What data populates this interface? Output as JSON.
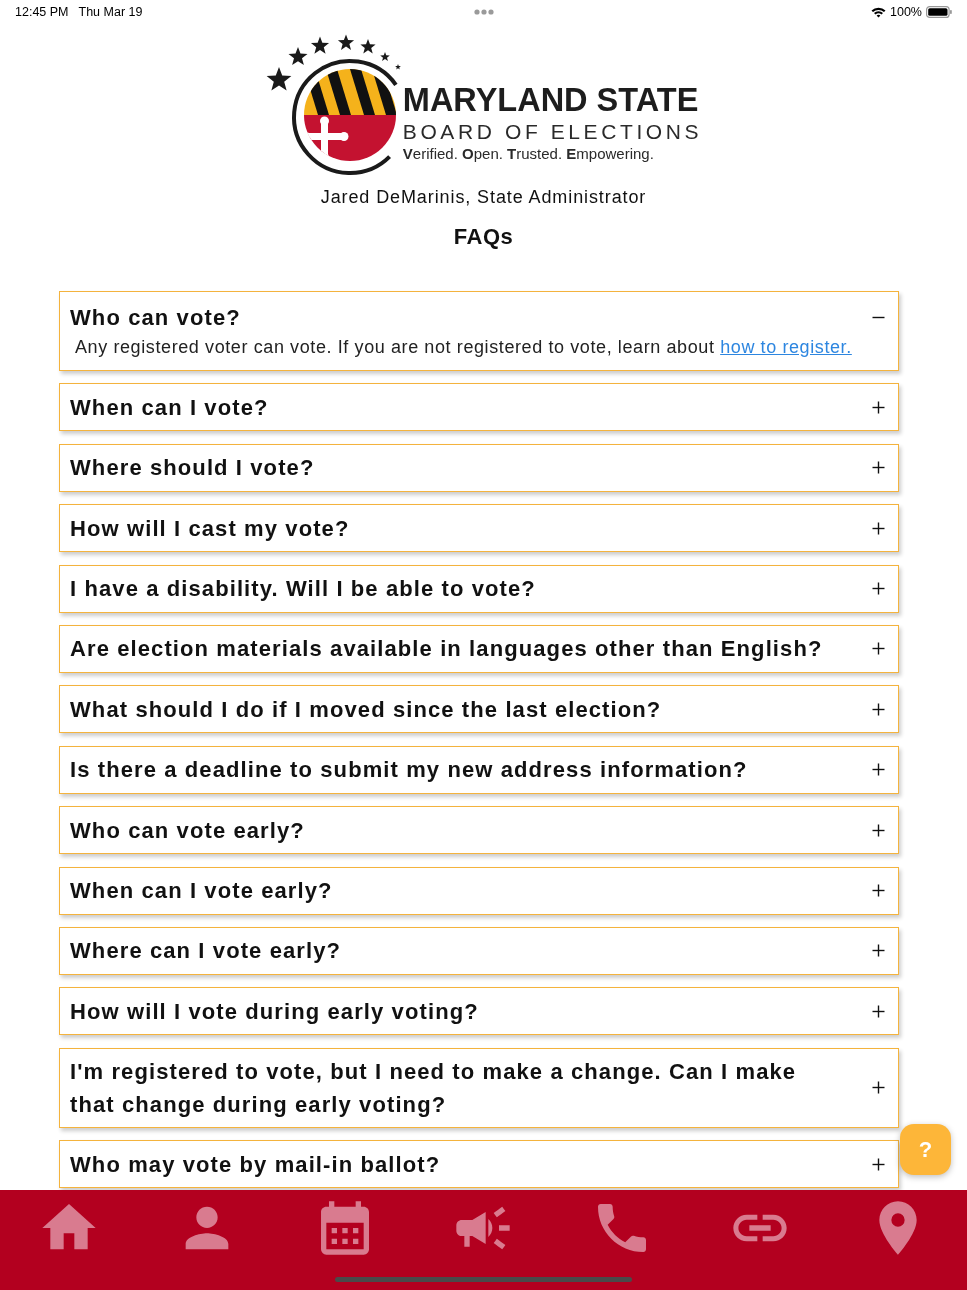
{
  "status_bar": {
    "time": "12:45 PM",
    "date": "Thu Mar 19",
    "battery": "100%"
  },
  "header": {
    "logo_title": "MARYLAND STATE",
    "logo_subtitle": "BOARD OF ELECTIONS",
    "logo_tagline": "**V**erified. **O**pen. **T**rusted. **E**mpowering.",
    "administrator": "Jared DeMarinis, State Administrator",
    "page_title": "FAQs"
  },
  "faqs": [
    {
      "question": "Who can vote?",
      "expanded": true,
      "answer": {
        "text": "Any registered voter can vote. If you are not registered to vote, learn about",
        "link": "how to register."
      }
    },
    {
      "question": "When can I vote?",
      "expanded": false
    },
    {
      "question": "Where should I vote?",
      "expanded": false
    },
    {
      "question": "How will I cast my vote?",
      "expanded": false
    },
    {
      "question": "I have a disability. Will I be able to vote?",
      "expanded": false
    },
    {
      "question": "Are election materials available in languages other than English?",
      "expanded": false
    },
    {
      "question": "What should I do if I moved since the last election?",
      "expanded": false
    },
    {
      "question": "Is there a deadline to submit my new address information?",
      "expanded": false
    },
    {
      "question": "Who can vote early?",
      "expanded": false
    },
    {
      "question": "When can I vote early?",
      "expanded": false
    },
    {
      "question": "Where can I vote early?",
      "expanded": false
    },
    {
      "question": "How will I vote during early voting?",
      "expanded": false
    },
    {
      "question": "I'm registered to vote, but I need to make a change. Can I make that change during early voting?",
      "expanded": false
    },
    {
      "question": "Who may vote by mail-in ballot?",
      "expanded": false
    }
  ],
  "help_button": {
    "label": "?"
  }
}
